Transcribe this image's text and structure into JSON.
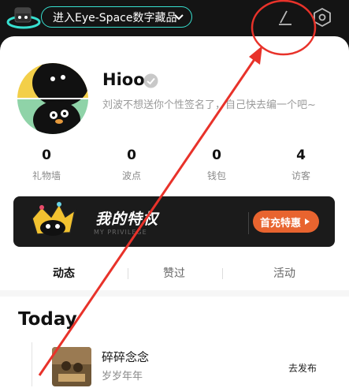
{
  "topbar": {
    "eye_space_label": "进入Eye-Space数字藏品",
    "edit_icon": "edit-pen-icon",
    "settings_icon": "gear-hexagon-icon",
    "accent": "#37e0d0"
  },
  "profile": {
    "name": "Hioo",
    "signature": "刘波不想送你个性签名了，自己快去编一个吧~",
    "verified_icon": "verified-check-icon"
  },
  "stats": [
    {
      "value": "0",
      "label": "礼物墙"
    },
    {
      "value": "0",
      "label": "波点"
    },
    {
      "value": "0",
      "label": "钱包"
    },
    {
      "value": "4",
      "label": "访客"
    }
  ],
  "banner": {
    "title": "我的特权",
    "subtitle": "MY PRIVILEGE",
    "button_label": "首充特惠",
    "button_color": "#e8642f"
  },
  "tabs": [
    {
      "label": "动态",
      "active": true
    },
    {
      "label": "赞过",
      "active": false
    },
    {
      "label": "活动",
      "active": false
    }
  ],
  "feed": {
    "section_title": "Today",
    "items": [
      {
        "title": "碎碎念念",
        "subtitle": "岁岁年年",
        "action": "去发布"
      }
    ]
  },
  "annotation_color": "#e8322a"
}
